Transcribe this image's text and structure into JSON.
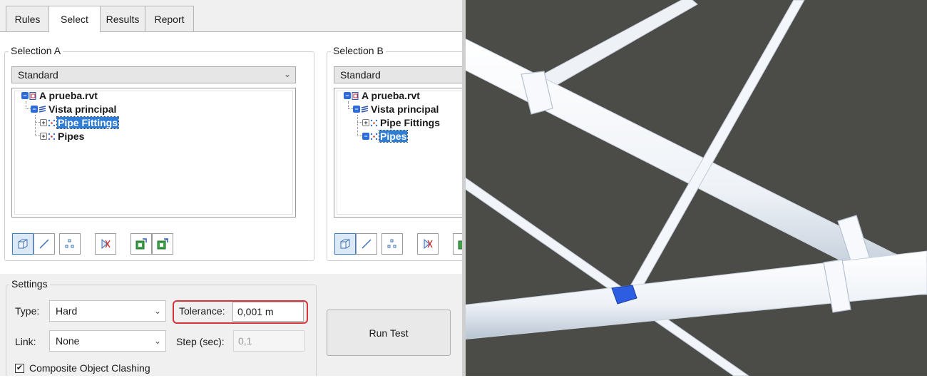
{
  "tabs": [
    {
      "label": "Rules",
      "active": false
    },
    {
      "label": "Select",
      "active": true
    },
    {
      "label": "Results",
      "active": false
    },
    {
      "label": "Report",
      "active": false
    }
  ],
  "selection_a": {
    "title": "Selection A",
    "dropdown": "Standard",
    "tree": {
      "file": "A prueba.rvt",
      "view": "Vista principal",
      "items": [
        {
          "label": "Pipe Fittings",
          "selected": true
        },
        {
          "label": "Pipes",
          "selected": false
        }
      ]
    }
  },
  "selection_b": {
    "title": "Selection B",
    "dropdown": "Standard",
    "tree": {
      "file": "A prueba.rvt",
      "view": "Vista principal",
      "items": [
        {
          "label": "Pipe Fittings",
          "selected": false
        },
        {
          "label": "Pipes",
          "selected": true
        }
      ]
    }
  },
  "toolbar_icons": [
    "surfaces-icon",
    "lines-icon",
    "points-icon",
    "self-intersect-icon",
    "save-selection-icon",
    "load-selection-icon"
  ],
  "settings": {
    "title": "Settings",
    "type_label": "Type:",
    "type_value": "Hard",
    "tolerance_label": "Tolerance:",
    "tolerance_value": "0,001 m",
    "link_label": "Link:",
    "link_value": "None",
    "step_label": "Step (sec):",
    "step_value": "0,1",
    "composite_label": "Composite Object Clashing",
    "composite_checked": true
  },
  "run_test_label": "Run Test",
  "colors": {
    "selection_highlight": "#2f7dd5",
    "tolerance_outline": "#d7333a",
    "viewport_background": "#4b4b48",
    "pipe_color": "#f2f5f9",
    "clash_highlight": "#2d5de0"
  }
}
